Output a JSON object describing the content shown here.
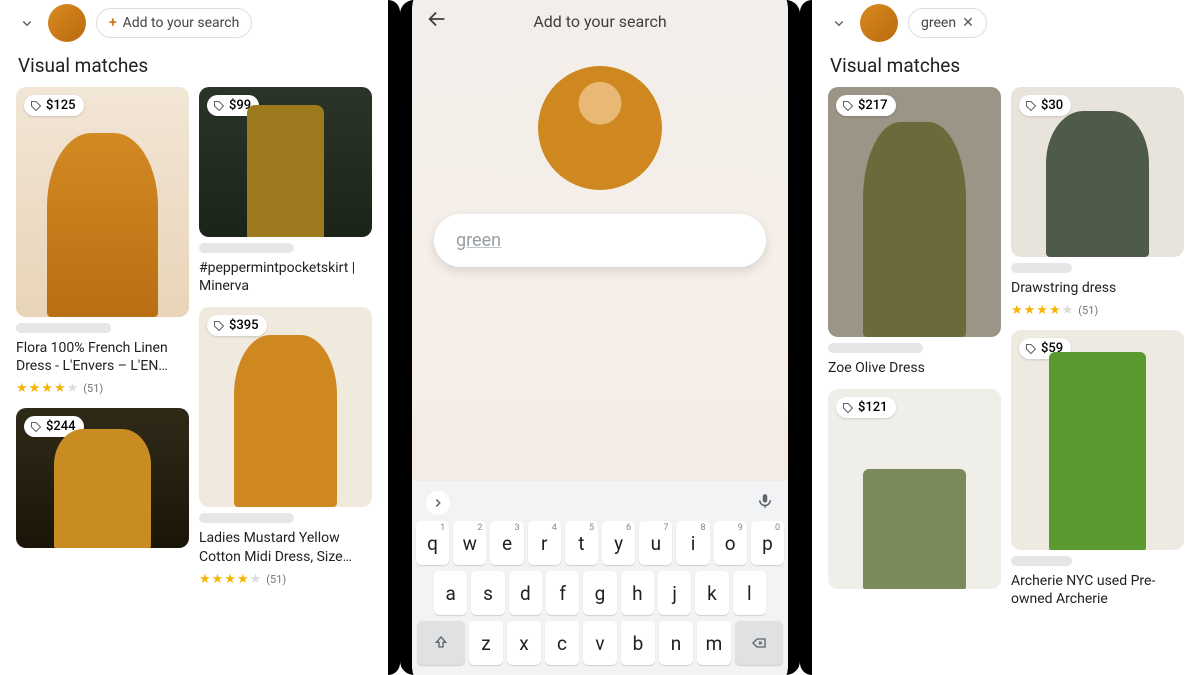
{
  "screen1": {
    "section_title": "Visual matches",
    "chip_label": "Add to your search",
    "cards": [
      {
        "price": "$125",
        "title": "Flora 100% French Linen Dress - L'Envers – L'EN…",
        "rating": "(51)"
      },
      {
        "price": "$99",
        "title": "#peppermintpocketskirt | Minerva"
      },
      {
        "price": "$244"
      },
      {
        "price": "$395",
        "title": "Ladies Mustard Yellow Cotton Midi Dress, Size…",
        "rating": "(51)"
      }
    ]
  },
  "screen2": {
    "title": "Add to your search",
    "input_value": "green",
    "keyboard_rows": [
      [
        "q",
        "w",
        "e",
        "r",
        "t",
        "y",
        "u",
        "i",
        "o",
        "p"
      ],
      [
        "a",
        "s",
        "d",
        "f",
        "g",
        "h",
        "j",
        "k",
        "l"
      ],
      [
        "z",
        "x",
        "c",
        "v",
        "b",
        "n",
        "m"
      ]
    ],
    "numbers": [
      "1",
      "2",
      "3",
      "4",
      "5",
      "6",
      "7",
      "8",
      "9",
      "0"
    ]
  },
  "screen3": {
    "section_title": "Visual matches",
    "chip_label": "green",
    "cards": [
      {
        "price": "$217",
        "title": "Zoe Olive Dress"
      },
      {
        "price": "$30",
        "title": "Drawstring dress",
        "rating": "(51)"
      },
      {
        "price": "$121"
      },
      {
        "price": "$59",
        "title": "Archerie NYC used Pre-owned Archerie"
      }
    ]
  }
}
